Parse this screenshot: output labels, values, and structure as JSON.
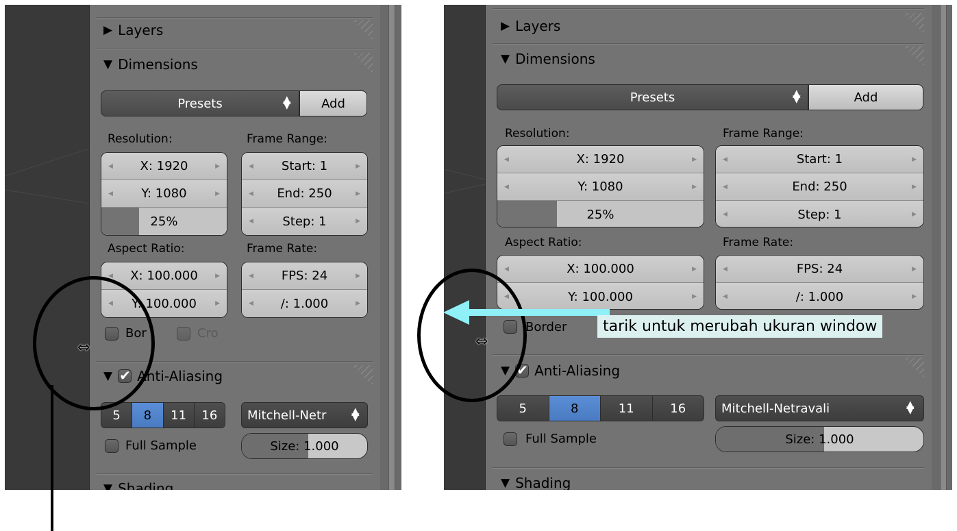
{
  "left_screenshot": {
    "headers": {
      "layers": "Layers",
      "dimensions": "Dimensions",
      "anti_aliasing": "Anti-Aliasing",
      "shading": "Shading"
    },
    "presets": {
      "label": "Presets",
      "add": "Add"
    },
    "labels": {
      "resolution": "Resolution:",
      "frame_range": "Frame Range:",
      "aspect_ratio": "Aspect Ratio:",
      "frame_rate": "Frame Rate:"
    },
    "resolution": {
      "x": "X: 1920",
      "y": "Y: 1080",
      "percent": "25%",
      "percent_value": 0.25
    },
    "frame_range": {
      "start": "Start: 1",
      "end": "End: 250",
      "step": "Step: 1"
    },
    "aspect": {
      "x": "X: 100.000",
      "y": "Y: 100.000"
    },
    "frame_rate": {
      "fps": "FPS: 24",
      "base": "/: 1.000"
    },
    "checkboxes": {
      "border": "Bor",
      "crop": "Cro"
    },
    "aa_samples": [
      "5",
      "8",
      "11",
      "16"
    ],
    "aa_selected": "8",
    "filter": "Mitchell-Netr",
    "full_sample": "Full Sample",
    "size": {
      "label": "Size: 1.000",
      "value": 1.0
    }
  },
  "right_screenshot": {
    "headers": {
      "layers": "Layers",
      "dimensions": "Dimensions",
      "anti_aliasing": "Anti-Aliasing",
      "shading": "Shading"
    },
    "presets": {
      "label": "Presets",
      "add": "Add"
    },
    "labels": {
      "resolution": "Resolution:",
      "frame_range": "Frame Range:",
      "aspect_ratio": "Aspect Ratio:",
      "frame_rate": "Frame Rate:"
    },
    "resolution": {
      "x": "X: 1920",
      "y": "Y: 1080",
      "percent": "25%",
      "percent_value": 0.25
    },
    "frame_range": {
      "start": "Start: 1",
      "end": "End: 250",
      "step": "Step: 1"
    },
    "aspect": {
      "x": "X: 100.000",
      "y": "Y: 100.000"
    },
    "frame_rate": {
      "fps": "FPS: 24",
      "base": "/: 1.000"
    },
    "checkboxes": {
      "border": "Border"
    },
    "aa_samples": [
      "5",
      "8",
      "11",
      "16"
    ],
    "aa_selected": "8",
    "filter": "Mitchell-Netravali",
    "full_sample": "Full Sample",
    "size": {
      "label": "Size: 1.000",
      "value": 1.0
    }
  },
  "annotation": {
    "tooltip": "tarik untuk merubah ukuran window",
    "arrow_color": "#8ff0f8",
    "cursor_icon": "horizontal-resize-cursor"
  },
  "colors": {
    "selected_segment": "#4a7bc2",
    "panel_bg": "#737373",
    "viewport_bg": "#393939"
  }
}
